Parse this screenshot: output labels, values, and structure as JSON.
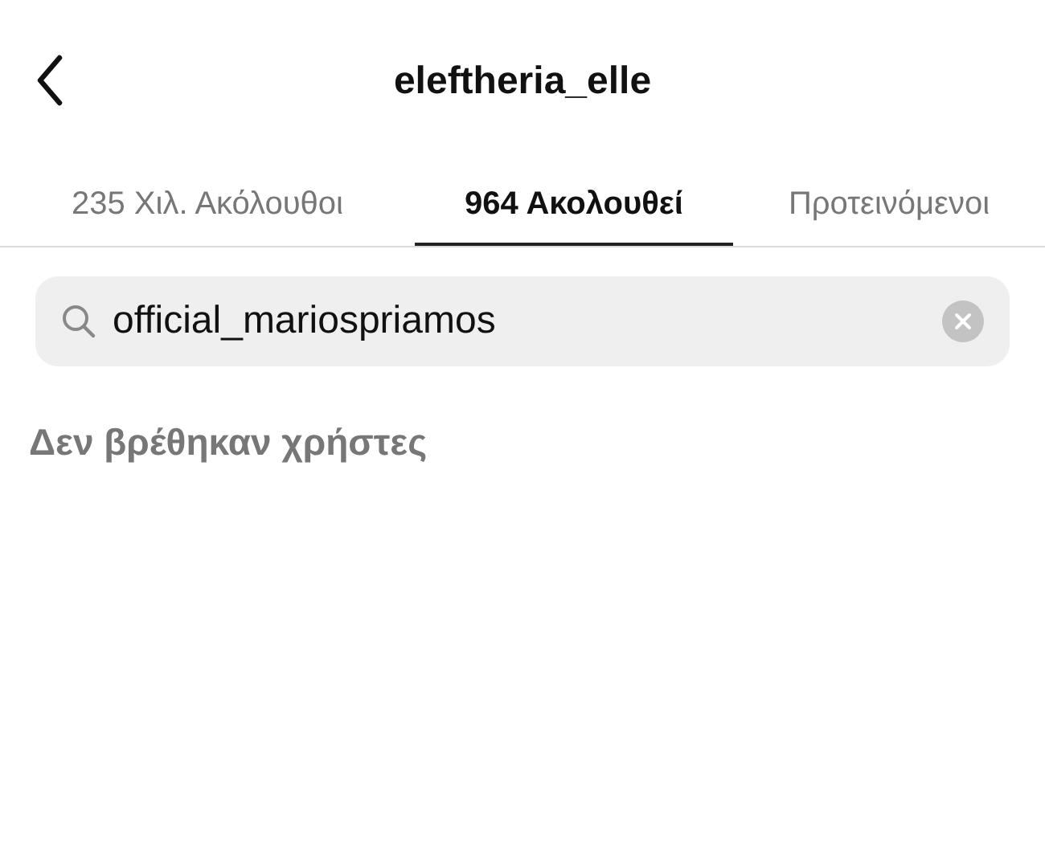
{
  "header": {
    "title": "eleftheria_elle"
  },
  "tabs": [
    {
      "label": "235 Χιλ. Ακόλουθοι",
      "selected": false
    },
    {
      "label": "964 Ακολουθεί",
      "selected": true
    },
    {
      "label": "Προτεινόμενοι",
      "selected": false
    }
  ],
  "search": {
    "value": "official_mariospriamos"
  },
  "empty_message": "Δεν βρέθηκαν χρήστες"
}
